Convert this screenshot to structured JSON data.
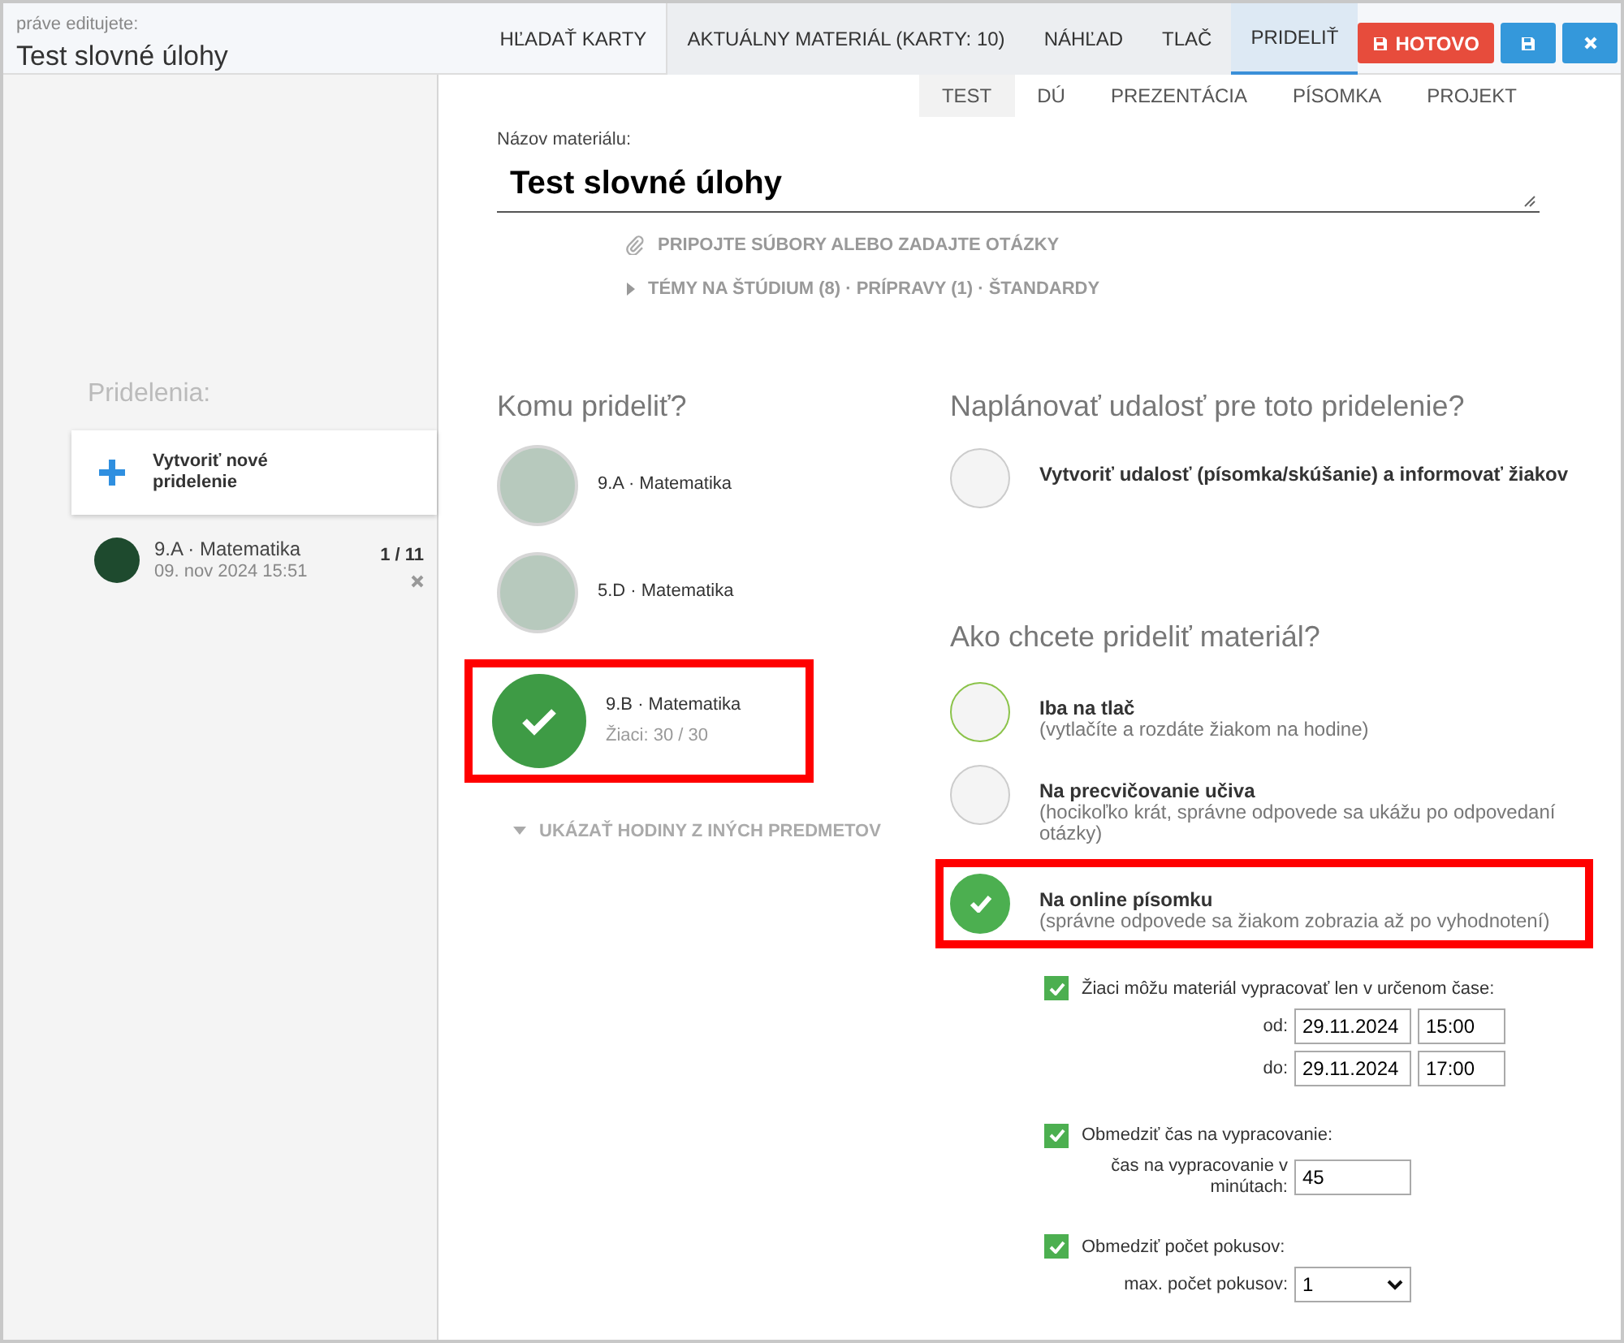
{
  "header": {
    "caption": "práve editujete:",
    "title": "Test slovné úlohy"
  },
  "nav_tabs": [
    {
      "label": "HĽADAŤ KARTY",
      "grouped": false,
      "selected": false
    },
    {
      "label": "AKTUÁLNY MATERIÁL (KARTY: 10)",
      "grouped": true,
      "selected": false
    },
    {
      "label": "NÁHĽAD",
      "grouped": true,
      "selected": false
    },
    {
      "label": "TLAČ",
      "grouped": true,
      "selected": false
    },
    {
      "label": "PRIDELIŤ",
      "grouped": true,
      "selected": true
    }
  ],
  "actions": [
    {
      "kind": "done",
      "label": "HOTOVO"
    },
    {
      "kind": "save"
    },
    {
      "kind": "close"
    }
  ],
  "type_tabs": [
    {
      "label": "TEST",
      "selected": true
    },
    {
      "label": "DÚ",
      "selected": false
    },
    {
      "label": "PREZENTÁCIA",
      "selected": false
    },
    {
      "label": "PÍSOMKA",
      "selected": false
    },
    {
      "label": "PROJEKT",
      "selected": false
    }
  ],
  "material": {
    "label": "Názov materiálu:",
    "value": "Test slovné úlohy"
  },
  "links": [
    {
      "kind": "attach",
      "label": "PRIPOJTE SÚBORY ALEBO ZADAJTE OTÁZKY"
    },
    {
      "kind": "topics",
      "label": "TÉMY NA ŠTÚDIUM (8) · PRÍPRAVY (1) · ŠTANDARDY"
    }
  ],
  "sidebar": {
    "heading": "Pridelenia:",
    "new_button": "Vytvoriť nové pridelenie",
    "assignments": [
      {
        "class": "9.A · Matematika",
        "date": "09. nov 2024 15:51",
        "count": "1 / 11"
      }
    ]
  },
  "recipients": {
    "heading": "Komu prideliť?",
    "classes": [
      {
        "name": "9.A · Matematika",
        "selected": false,
        "highlighted": false
      },
      {
        "name": "5.D · Matematika",
        "selected": false,
        "highlighted": false
      },
      {
        "name": "9.B · Matematika",
        "students": "Žiaci: 30 / 30",
        "selected": true,
        "highlighted": true
      }
    ],
    "more_link": "UKÁZAŤ HODINY Z INÝCH PREDMETOV"
  },
  "event": {
    "heading": "Naplánovať udalosť pre toto pridelenie?",
    "options": [
      {
        "label": "Vytvoriť udalosť (písomka/skúšanie) a informovať žiakov",
        "selected": false,
        "hovered": false,
        "highlighted": false
      }
    ]
  },
  "mode": {
    "heading": "Ako chcete prideliť materiál?",
    "options": [
      {
        "label": "Iba na tlač",
        "note": "(vytlačíte a rozdáte žiakom na hodine)",
        "selected": false,
        "hovered": true,
        "highlighted": false
      },
      {
        "label": "Na precvičovanie učiva",
        "note": "(hocikoľko krát, správne odpovede sa ukážu po odpovedaní otázky)",
        "selected": false,
        "hovered": false,
        "highlighted": false
      },
      {
        "label": "Na online písomku",
        "note": "(správne odpovede sa žiakom zobrazia až po vyhodnotení)",
        "selected": true,
        "hovered": false,
        "highlighted": true
      }
    ]
  },
  "settings": [
    {
      "label": "Žiaci môžu materiál vypracovať len v určenom čase:",
      "checked": true,
      "rows": [
        {
          "kind": "datetime",
          "label": "od:",
          "date": "29.11.2024",
          "time": "15:00"
        },
        {
          "kind": "datetime",
          "label": "do:",
          "date": "29.11.2024",
          "time": "17:00"
        }
      ]
    },
    {
      "label": "Obmedziť čas na vypracovanie:",
      "checked": true,
      "rows": [
        {
          "kind": "number",
          "label": "čas na vypracovanie v minútach:",
          "value": "45"
        }
      ]
    },
    {
      "label": "Obmedziť počet pokusov:",
      "checked": true,
      "rows": [
        {
          "kind": "select",
          "label": "max. počet pokusov:",
          "value": "1"
        }
      ]
    }
  ]
}
